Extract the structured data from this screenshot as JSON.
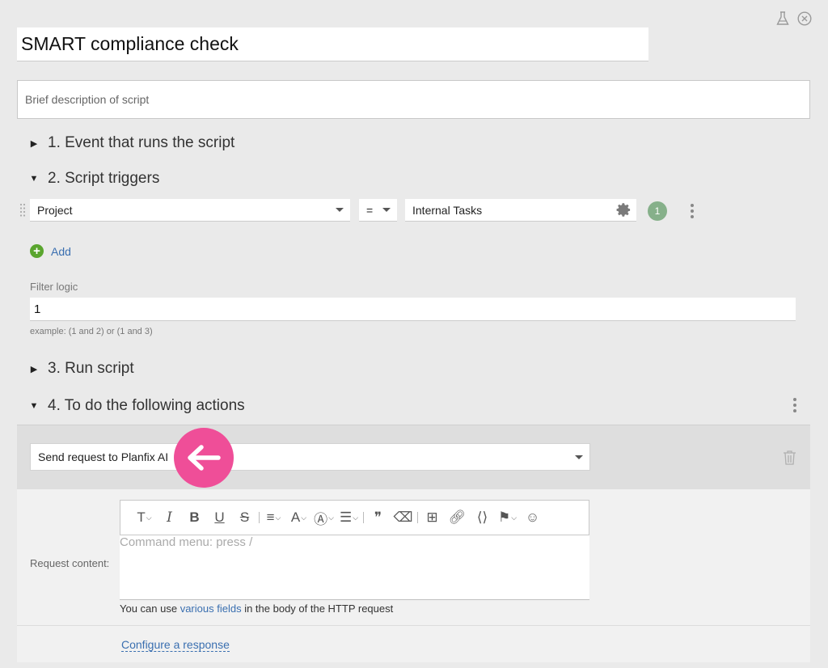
{
  "title": "SMART compliance check",
  "description_placeholder": "Brief description of script",
  "sections": {
    "s1": "1. Event that runs the script",
    "s2": "2. Script triggers",
    "s3": "3. Run script",
    "s4": "4. To do the following actions"
  },
  "trigger": {
    "field": "Project",
    "operator": "=",
    "value": "Internal Tasks",
    "badge": "1"
  },
  "add_label": "Add",
  "filter_logic": {
    "label": "Filter logic",
    "value": "1",
    "example": "example: (1 and 2) or (1 and 3)"
  },
  "action": {
    "selected": "Send request to Planfix AI",
    "request_label": "Request content:",
    "editor_placeholder": "Command menu: press /",
    "hint_prefix": "You can use ",
    "hint_link": "various fields",
    "hint_suffix": " in the body of the HTTP request",
    "configure": "Configure a response"
  },
  "colors": {
    "accent": "#3a6fb0",
    "badge": "#86b08a",
    "add_icon": "#5aa52e",
    "pointer": "#ef4e98"
  }
}
